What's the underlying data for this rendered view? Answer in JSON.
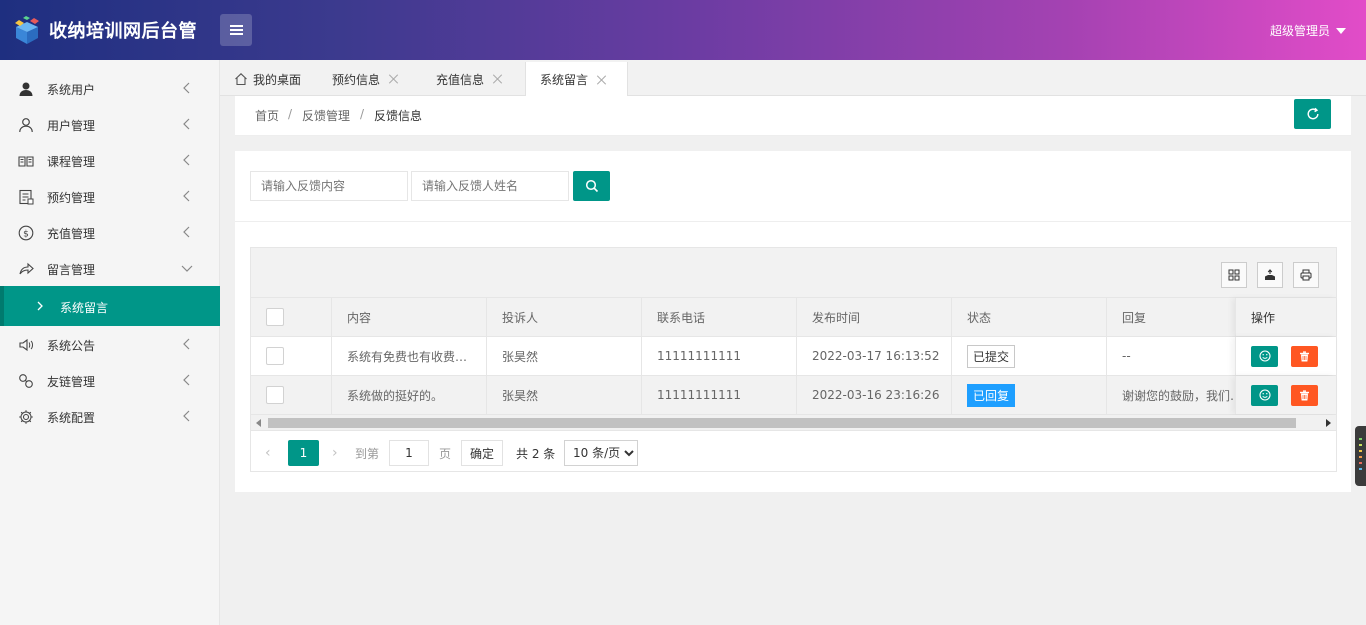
{
  "header": {
    "app_title": "收纳培训网后台管",
    "user_label": "超级管理员"
  },
  "sidebar": {
    "items": [
      {
        "label": "系统用户",
        "icon": "user-solid-icon"
      },
      {
        "label": "用户管理",
        "icon": "user-outline-icon"
      },
      {
        "label": "课程管理",
        "icon": "book-icon"
      },
      {
        "label": "预约管理",
        "icon": "calendar-icon"
      },
      {
        "label": "充值管理",
        "icon": "dollar-icon"
      },
      {
        "label": "留言管理",
        "icon": "share-icon"
      },
      {
        "label": "系统公告",
        "icon": "speaker-icon"
      },
      {
        "label": "友链管理",
        "icon": "link-icon"
      },
      {
        "label": "系统配置",
        "icon": "gear-icon"
      }
    ],
    "active_sub": {
      "label": "系统留言"
    }
  },
  "tabs": [
    {
      "label": "我的桌面"
    },
    {
      "label": "预约信息"
    },
    {
      "label": "充值信息"
    },
    {
      "label": "系统留言"
    }
  ],
  "breadcrumb": {
    "home": "首页",
    "section": "反馈管理",
    "current": "反馈信息",
    "sep": "/"
  },
  "search": {
    "content_placeholder": "请输入反馈内容",
    "name_placeholder": "请输入反馈人姓名"
  },
  "table": {
    "headers": [
      "内容",
      "投诉人",
      "联系电话",
      "发布时间",
      "状态",
      "回复",
      "操作"
    ],
    "rows": [
      {
        "content": "系统有免费也有收费…",
        "author": "张昊然",
        "phone": "11111111111",
        "time": "2022-03-17 16:13:52",
        "status": "已提交",
        "reply": "--"
      },
      {
        "content": "系统做的挺好的。",
        "author": "张昊然",
        "phone": "11111111111",
        "time": "2022-03-16 23:16:26",
        "status": "已回复",
        "reply": "谢谢您的鼓励，我们…"
      }
    ]
  },
  "pagination": {
    "current_page": "1",
    "goto_label": "到第",
    "goto_value": "1",
    "page_unit": "页",
    "confirm_label": "确定",
    "total_label": "共 2 条",
    "page_size_option": "10 条/页"
  },
  "colors": {
    "primary": "#009688",
    "danger": "#ff5722",
    "info": "#1e9fff"
  }
}
